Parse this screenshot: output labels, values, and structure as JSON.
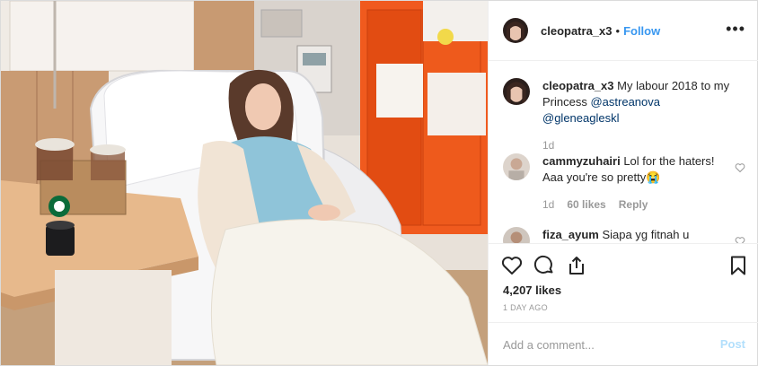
{
  "header": {
    "username": "cleopatra_x3",
    "separator": "•",
    "follow_label": "Follow",
    "more_icon": "more-options-icon",
    "more_label": "•••"
  },
  "caption": {
    "username": "cleopatra_x3",
    "text": "My labour 2018 to my Princess",
    "mention_1": "@astreanova",
    "mention_2": "@gleneagleskl",
    "age": "1d"
  },
  "comments": [
    {
      "username": "cammyzuhairi",
      "text": "Lol for the haters! Aaa you're so pretty😭",
      "age": "1d",
      "likes": "60 likes",
      "reply_label": "Reply"
    },
    {
      "username": "fiza_ayum",
      "text": "Siapa yg fitnah u"
    }
  ],
  "actions": {
    "like_icon": "heart-icon",
    "comment_icon": "comment-icon",
    "share_icon": "share-icon",
    "save_icon": "bookmark-icon",
    "likes_count": "4,207 likes",
    "posted": "1 DAY AGO"
  },
  "add_comment": {
    "placeholder": "Add a comment...",
    "post_label": "Post"
  },
  "colors": {
    "link_blue": "#3897f0",
    "post_disabled": "#b2dffc",
    "muted": "#999999",
    "text": "#262626"
  },
  "photo": {
    "description_icon": "hospital-photo",
    "cup_brand": "STARBUCKS"
  }
}
